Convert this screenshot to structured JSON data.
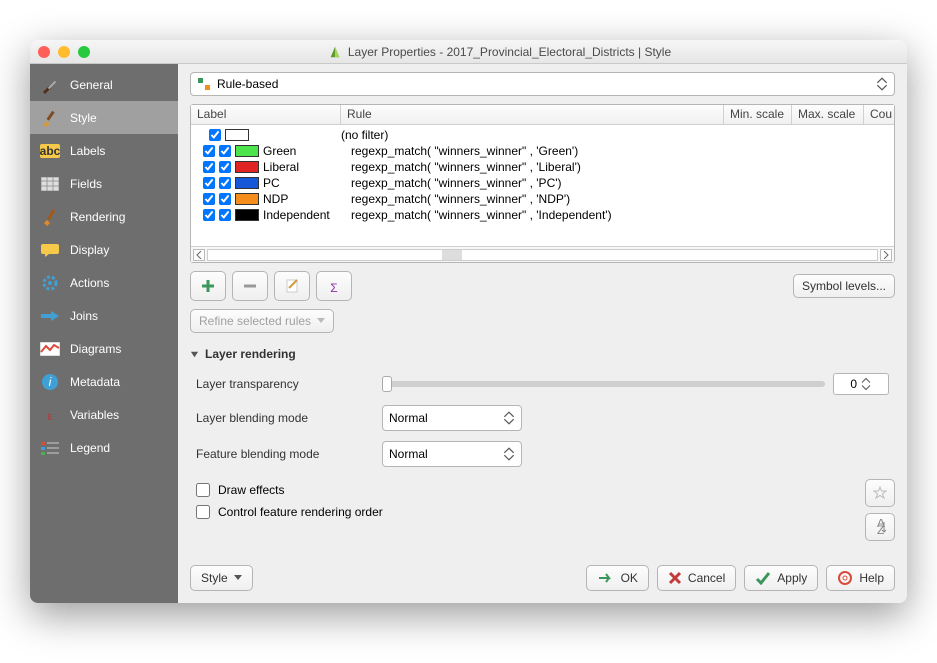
{
  "window": {
    "title": "Layer Properties - 2017_Provincial_Electoral_Districts | Style"
  },
  "sidebar": {
    "items": [
      {
        "label": "General"
      },
      {
        "label": "Style",
        "selected": true
      },
      {
        "label": "Labels"
      },
      {
        "label": "Fields"
      },
      {
        "label": "Rendering"
      },
      {
        "label": "Display"
      },
      {
        "label": "Actions"
      },
      {
        "label": "Joins"
      },
      {
        "label": "Diagrams"
      },
      {
        "label": "Metadata"
      },
      {
        "label": "Variables"
      },
      {
        "label": "Legend"
      }
    ]
  },
  "renderer_dropdown": "Rule-based",
  "columns": {
    "label": "Label",
    "rule": "Rule",
    "min": "Min. scale",
    "max": "Max. scale",
    "count": "Cou"
  },
  "rules": [
    {
      "checked": true,
      "swatch": "#ffffff",
      "label": "",
      "expr": "(no filter)"
    },
    {
      "checked": true,
      "swatch": "#4de34d",
      "label": "Green",
      "expr": "regexp_match(  \"winners_winner\" , 'Green')"
    },
    {
      "checked": true,
      "swatch": "#e02424",
      "label": "Liberal",
      "expr": "regexp_match(  \"winners_winner\" , 'Liberal')"
    },
    {
      "checked": true,
      "swatch": "#1656d8",
      "label": "PC",
      "expr": "regexp_match(  \"winners_winner\" , 'PC')"
    },
    {
      "checked": true,
      "swatch": "#f58d1d",
      "label": "NDP",
      "expr": "regexp_match(  \"winners_winner\" , 'NDP')"
    },
    {
      "checked": true,
      "swatch": "#000000",
      "label": "Independent",
      "expr": "regexp_match(  \"winners_winner\" , 'Independent')"
    }
  ],
  "buttons": {
    "symbol_levels": "Symbol levels...",
    "refine": "Refine selected rules",
    "style_menu": "Style",
    "ok": "OK",
    "cancel": "Cancel",
    "apply": "Apply",
    "help": "Help"
  },
  "section": {
    "layer_rendering": "Layer rendering"
  },
  "form": {
    "transparency_label": "Layer transparency",
    "transparency_value": "0",
    "layer_blend_label": "Layer blending mode",
    "layer_blend_value": "Normal",
    "feature_blend_label": "Feature blending mode",
    "feature_blend_value": "Normal",
    "draw_effects": "Draw effects",
    "control_order": "Control feature rendering order"
  }
}
